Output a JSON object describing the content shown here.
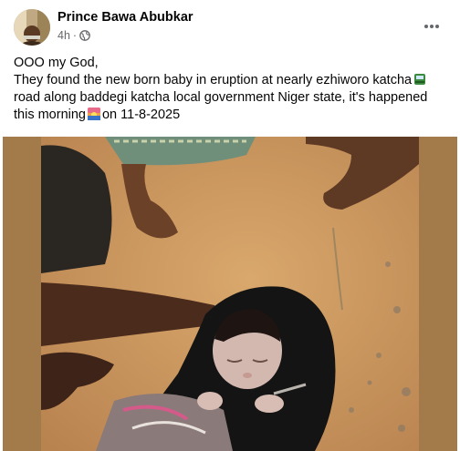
{
  "post": {
    "author": "Prince Bawa Abubkar",
    "time": "4h",
    "separator": "·",
    "audience_icon": "globe-icon",
    "more_icon": "more-options-icon",
    "text_line1": "OOO my God,",
    "text_line2a": "They found the new born baby in eruption at nearly ezhiworo katcha",
    "text_line2b": "road along baddegi katcha local government Niger state, it's happened this morning",
    "text_line2c": "on 11-8-2025",
    "emoji1": "railway-car-emoji",
    "emoji2": "sunrise-emoji"
  },
  "colors": {
    "text": "#050505",
    "meta": "#65676b",
    "photo_border": "#a37a4a",
    "ground": "#c89560"
  }
}
